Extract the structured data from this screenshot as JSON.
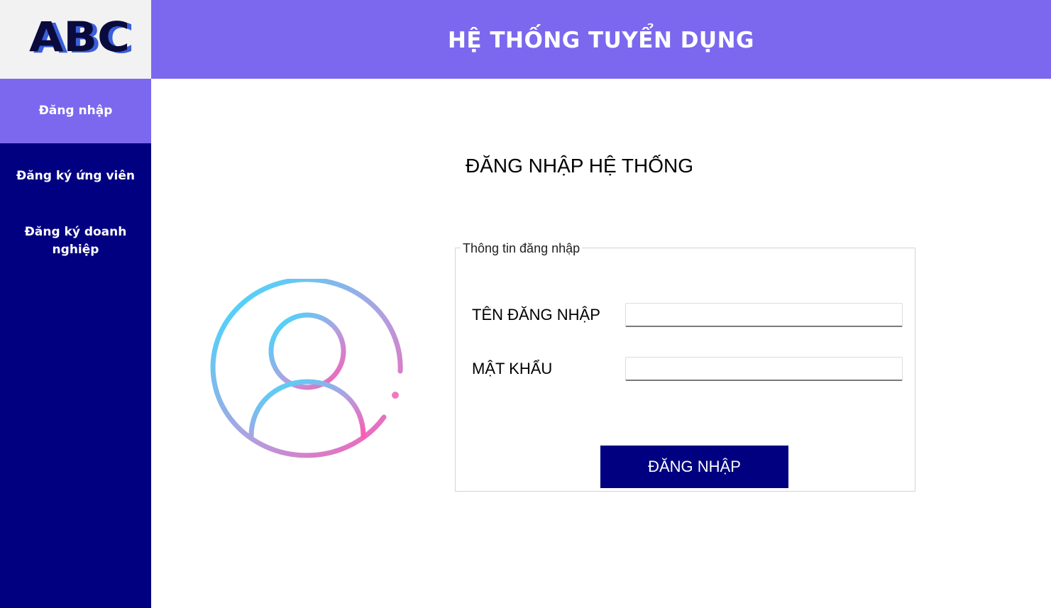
{
  "logo": {
    "text": "ABC",
    "colors": {
      "fill": "#0a0a3c",
      "shadow": "#3a5fd9"
    }
  },
  "header": {
    "title": "HỆ THỐNG TUYỂN DỤNG",
    "background": "#7b68ee"
  },
  "sidebar": {
    "background": "#000080",
    "active_background": "#7b68ee",
    "items": [
      {
        "label": "Đăng nhập",
        "active": true
      },
      {
        "label": "Đăng ký ứng viên",
        "active": false
      },
      {
        "label": "Đăng ký doanh nghiệp",
        "active": false
      }
    ]
  },
  "main": {
    "title": "ĐĂNG NHẬP HỆ THỐNG",
    "avatar_icon": "user-circle-icon",
    "avatar_gradient": [
      "#36e0ff",
      "#ff5ab0"
    ],
    "form": {
      "legend": "Thông tin đăng nhập",
      "username_label": "TÊN ĐĂNG NHẬP",
      "username_value": "",
      "password_label": "MẬT KHẨU",
      "password_value": "",
      "submit_label": "ĐĂNG NHẬP"
    }
  }
}
